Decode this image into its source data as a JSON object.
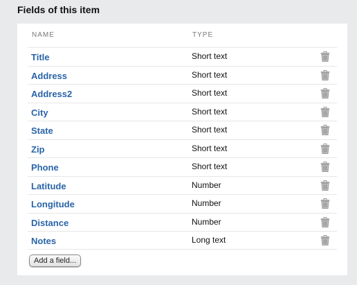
{
  "section": {
    "title": "Fields of this item"
  },
  "table": {
    "columns": {
      "name": "NAME",
      "type": "TYPE"
    },
    "rows": [
      {
        "name": "Title",
        "type": "Short text"
      },
      {
        "name": "Address",
        "type": "Short text"
      },
      {
        "name": "Address2",
        "type": "Short text"
      },
      {
        "name": "City",
        "type": "Short text"
      },
      {
        "name": "State",
        "type": "Short text"
      },
      {
        "name": "Zip",
        "type": "Short text"
      },
      {
        "name": "Phone",
        "type": "Short text"
      },
      {
        "name": "Latitude",
        "type": "Number"
      },
      {
        "name": "Longitude",
        "type": "Number"
      },
      {
        "name": "Distance",
        "type": "Number"
      },
      {
        "name": "Notes",
        "type": "Long text"
      }
    ],
    "delete_icon": "trash-icon"
  },
  "actions": {
    "add_field_label": "Add a field..."
  },
  "colors": {
    "link": "#2a64a8",
    "background": "#e8eaec",
    "panel": "#ffffff"
  }
}
